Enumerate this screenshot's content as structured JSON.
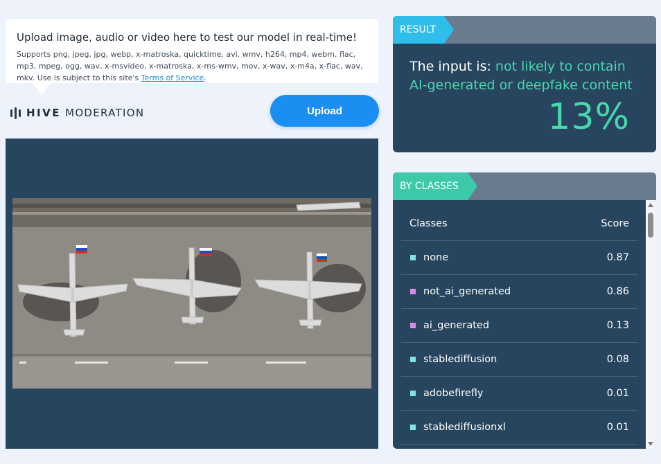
{
  "upload_card": {
    "title": "Upload image, audio or video here to test our model in real-time!",
    "description": "Supports png, jpeg, jpg, webp, x-matroska, quicktime, avi, wmv, h264, mp4, webm, flac, mp3, mpeg, ogg, wav, x-msvideo, x-matroska, x-ms-wmv, mov, x-wav, x-m4a, x-flac, wav, mkv. Use is subject to this site's ",
    "tos_link": "Terms of Service",
    "tos_end": "."
  },
  "logo": {
    "bold": "HIVE",
    "light": "MODERATION"
  },
  "upload_button": "Upload",
  "preview": {
    "image": "aerial-photo-of-three-bomber-aircraft-on-tarmac"
  },
  "result": {
    "tag": "RESULT",
    "prefix": "The input is: ",
    "verdict": "not likely to contain AI-generated or deepfake content",
    "percent": "13%"
  },
  "classes": {
    "tag": "BY CLASSES",
    "header": {
      "classes": "Classes",
      "score": "Score"
    },
    "rows": [
      {
        "name": "none",
        "score": "0.87",
        "color": "#7fe3e0"
      },
      {
        "name": "not_ai_generated",
        "score": "0.86",
        "color": "#d98ae6"
      },
      {
        "name": "ai_generated",
        "score": "0.13",
        "color": "#d98ae6"
      },
      {
        "name": "stablediffusion",
        "score": "0.08",
        "color": "#7fe3e0"
      },
      {
        "name": "adobefirefly",
        "score": "0.01",
        "color": "#7fe3e0"
      },
      {
        "name": "stablediffusionxl",
        "score": "0.01",
        "color": "#7fe3e0"
      }
    ]
  },
  "colors": {
    "accent_blue": "#1b8ef2",
    "result_tag": "#2fbde9",
    "classes_tag": "#3ec9aa",
    "verdict_green": "#4ad6ae",
    "panel_bg": "#27455e"
  }
}
